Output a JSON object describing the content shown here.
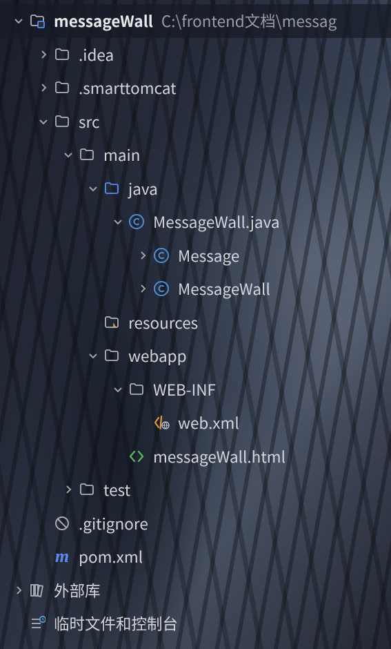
{
  "root": {
    "name": "messageWall",
    "path": "C:\\frontend文档\\messag"
  },
  "nodes": {
    "idea": ".idea",
    "smarttomcat": ".smarttomcat",
    "src": "src",
    "main": "main",
    "java": "java",
    "messageWallJava": "MessageWall.java",
    "messageClass": "Message",
    "messageWallClass": "MessageWall",
    "resources": "resources",
    "webapp": "webapp",
    "webinf": "WEB-INF",
    "webxml": "web.xml",
    "messageWallHtml": "messageWall.html",
    "test": "test",
    "gitignore": ".gitignore",
    "pomxml": "pom.xml",
    "externalLibs": "外部库",
    "scratches": "临时文件和控制台"
  }
}
